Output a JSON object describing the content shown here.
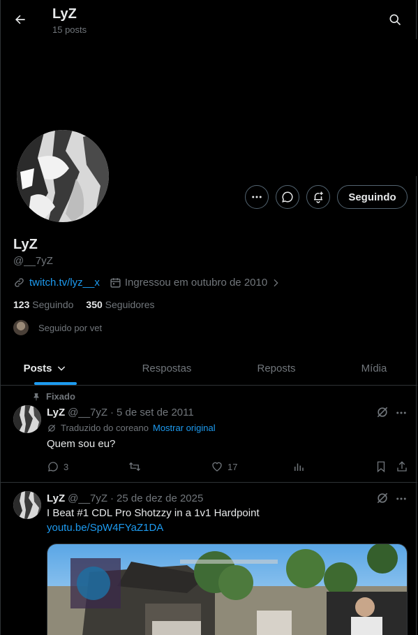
{
  "header": {
    "title": "LyZ",
    "subtitle": "15 posts",
    "back_icon": "arrow-left-icon",
    "search_icon": "search-icon"
  },
  "profile": {
    "display_name": "LyZ",
    "handle": "@__7yZ",
    "link": "twitch.tv/lyz__x",
    "joined": "Ingressou em outubro de 2010",
    "following_count": "123",
    "following_label": "Seguindo",
    "followers_count": "350",
    "followers_label": "Seguidores",
    "followed_by": "Seguido por vet",
    "follow_button": "Seguindo"
  },
  "tabs": [
    "Posts",
    "Respostas",
    "Reposts",
    "Mídia"
  ],
  "tweets": [
    {
      "pinned_label": "Fixado",
      "author": "LyZ",
      "handle": "@__7yZ",
      "date": "5 de set de 2011",
      "translated_label": "Traduzido do coreano",
      "show_original": "Mostrar original",
      "text": "Quem sou eu?",
      "replies": "3",
      "reposts": "",
      "likes": "17"
    },
    {
      "author": "LyZ",
      "handle": "@__7yZ",
      "date": "25 de dez de 2025",
      "text": "I Beat #1 CDL Pro Shotzzy in a 1v1 Hardpoint",
      "link": "youtu.be/SpW4FYaZ1DA"
    }
  ],
  "colors": {
    "accent": "#1d9bf0",
    "background": "#000000",
    "muted": "#71767b",
    "border": "#2f3336"
  }
}
